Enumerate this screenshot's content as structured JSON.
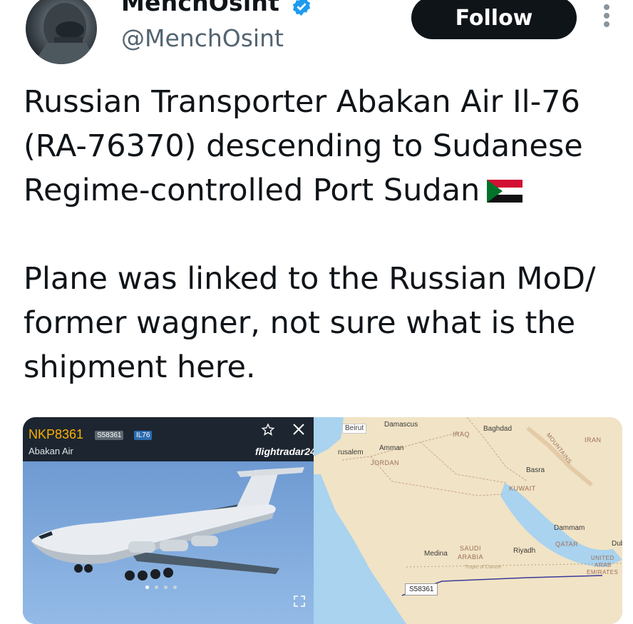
{
  "header": {
    "display_name": "MenchOsint",
    "handle": "@MenchOsint",
    "follow_label": "Follow",
    "verified_icon": "verified-badge-icon",
    "more_icon": "more-vertical-icon"
  },
  "tweet": {
    "paragraph1": "Russian Transporter Abakan Air Il-76 (RA-76370) descending to Sudanese Regime-controlled Port Sudan",
    "paragraph2": "Plane was linked to the Russian MoD/ former wagner, not sure what is the shipment here.",
    "flag_icon": "sudan-flag-icon"
  },
  "media": {
    "photo": {
      "callsign": "NKP8361",
      "registration_badge": "S58361",
      "type_badge": "IL76",
      "airline": "Abakan Air",
      "logo_text": "flightradar24",
      "carousel_pages": 4,
      "carousel_active": 1
    },
    "map": {
      "flight_tag": "S58361",
      "labels": {
        "beirut": "Beirut",
        "damascus": "Damascus",
        "jerusalem": "rusalem",
        "amman": "Amman",
        "jordan": "JORDAN",
        "iraq": "IRAQ",
        "baghdad": "Baghdad",
        "iran": "IRAN",
        "basra": "Basra",
        "kuwait": "KUWAIT",
        "dammam": "Dammam",
        "qatar": "QATAR",
        "dubai": "Dubai",
        "uae1": "UNITED",
        "uae2": "ARAB",
        "uae3": "EMIRATES",
        "riyadh": "Riyadh",
        "saudi1": "SAUDI",
        "saudi2": "ARABIA",
        "medina": "Medina",
        "tropic": "Tropic of Cancer",
        "mountains": "MOUNTAINS"
      },
      "colors": {
        "land": "#f1e3c5",
        "sea": "#a9d3ee",
        "track": "#3a3a9a"
      }
    }
  },
  "colors": {
    "follow_bg": "#0f1419",
    "verified": "#1d9bf0",
    "handle": "#536471",
    "callsign": "#ffb000"
  }
}
